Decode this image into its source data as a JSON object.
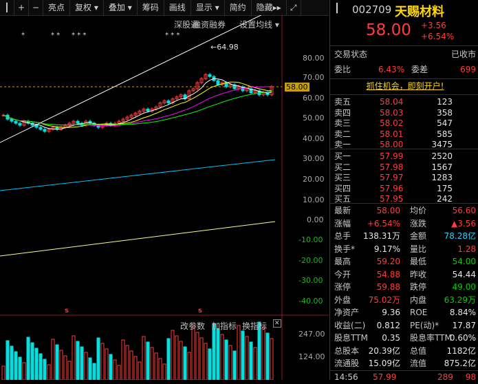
{
  "toolbar": {
    "items": [
      "亮点",
      "复权",
      "叠加",
      "筹码",
      "画线",
      "显示",
      "简约",
      "隐藏"
    ]
  },
  "chart_top_menu": [
    "深股通",
    "融资融券",
    "设置均线"
  ],
  "price_axis": [
    "80.00",
    "70.00",
    "58.00",
    "60.00",
    "50.00",
    "40.00",
    "30.00",
    "20.00",
    "10.00",
    "0.00",
    "-10.00",
    "-20.00",
    "-30.00",
    "-40.00"
  ],
  "annotations": {
    "high_label": "64.98",
    "top_marks": [
      "*",
      "* *",
      "* * *",
      "* * *",
      "*  *  *"
    ],
    "s_marks": [
      "s",
      "s"
    ]
  },
  "volume_menu": [
    "改参数",
    "加指标",
    "换指标"
  ],
  "volume_axis": [
    "247.00",
    "124.00"
  ],
  "header": {
    "code": "002709",
    "name": "天赐材料",
    "price": "58.00",
    "change": "+3.56",
    "change_pct": "+6.54%"
  },
  "status": {
    "label": "交易状态",
    "value": "已收市",
    "ratio_label": "委比",
    "ratio_value": "6.43%",
    "diff_label": "委差",
    "diff_value": "699"
  },
  "promo": "抓住机会，即刻开户!",
  "asks": [
    {
      "label": "卖五",
      "price": "58.04",
      "vol": "123"
    },
    {
      "label": "卖四",
      "price": "58.03",
      "vol": "358"
    },
    {
      "label": "卖三",
      "price": "58.02",
      "vol": "547"
    },
    {
      "label": "卖二",
      "price": "58.01",
      "vol": "585"
    },
    {
      "label": "卖一",
      "price": "58.00",
      "vol": "3475"
    }
  ],
  "bids": [
    {
      "label": "买一",
      "price": "57.99",
      "vol": "2520"
    },
    {
      "label": "买二",
      "price": "57.98",
      "vol": "1567"
    },
    {
      "label": "买三",
      "price": "57.97",
      "vol": "1283"
    },
    {
      "label": "买四",
      "price": "57.96",
      "vol": "175"
    },
    {
      "label": "买五",
      "price": "57.95",
      "vol": "242"
    }
  ],
  "stats": [
    {
      "l1": "最新",
      "v1": "58.00",
      "c1": "r",
      "l2": "均价",
      "v2": "56.60",
      "c2": "r"
    },
    {
      "l1": "涨幅",
      "v1": "+6.54%",
      "c1": "r",
      "l2": "涨跌",
      "v2": "▲3.56",
      "c2": "r"
    },
    {
      "l1": "总手",
      "v1": "138.31万",
      "c1": "w",
      "l2": "金额",
      "v2": "78.28亿",
      "c2": "c"
    },
    {
      "l1": "换手*",
      "v1": "9.17%",
      "c1": "w",
      "l2": "量比",
      "v2": "1.28",
      "c2": "r"
    },
    {
      "l1": "最高",
      "v1": "59.20",
      "c1": "r",
      "l2": "最低",
      "v2": "54.00",
      "c2": "g"
    },
    {
      "l1": "今开",
      "v1": "54.88",
      "c1": "r",
      "l2": "昨收",
      "v2": "54.44",
      "c2": "w"
    },
    {
      "l1": "涨停",
      "v1": "59.88",
      "c1": "r",
      "l2": "跌停",
      "v2": "49.00",
      "c2": "g"
    },
    {
      "l1": "外盘",
      "v1": "75.02万",
      "c1": "r",
      "l2": "内盘",
      "v2": "63.29万",
      "c2": "g"
    },
    {
      "l1": "净资产",
      "v1": "9.36",
      "c1": "w",
      "l2": "ROE",
      "v2": "8.84%",
      "c2": "w"
    },
    {
      "l1": "收益(二)",
      "v1": "0.812",
      "c1": "w",
      "l2": "PE(动)*",
      "v2": "17.87",
      "c2": "w"
    },
    {
      "l1": "股息TTM",
      "v1": "0.35",
      "c1": "w",
      "l2": "股息率TTM",
      "v2": "0.60%",
      "c2": "w"
    },
    {
      "l1": "总股本",
      "v1": "20.39亿",
      "c1": "w",
      "l2": "总值",
      "v2": "1182亿",
      "c2": "w"
    },
    {
      "l1": "流通股",
      "v1": "15.09亿",
      "c1": "w",
      "l2": "流值",
      "v2": "875.2亿",
      "c2": "w"
    }
  ],
  "tick": {
    "time": "14:56",
    "price": "57.99",
    "vol": "289",
    "n": "98"
  },
  "colors": {
    "up": "#ff3c3c",
    "down": "#00e0e0",
    "ma5": "#ffffff",
    "ma10": "#ffff00",
    "ma20": "#ff00ff",
    "ma30": "#00ff00",
    "ma60": "#ffffff",
    "ma120": "#00c0ff",
    "ma250": "#ffff80"
  }
}
